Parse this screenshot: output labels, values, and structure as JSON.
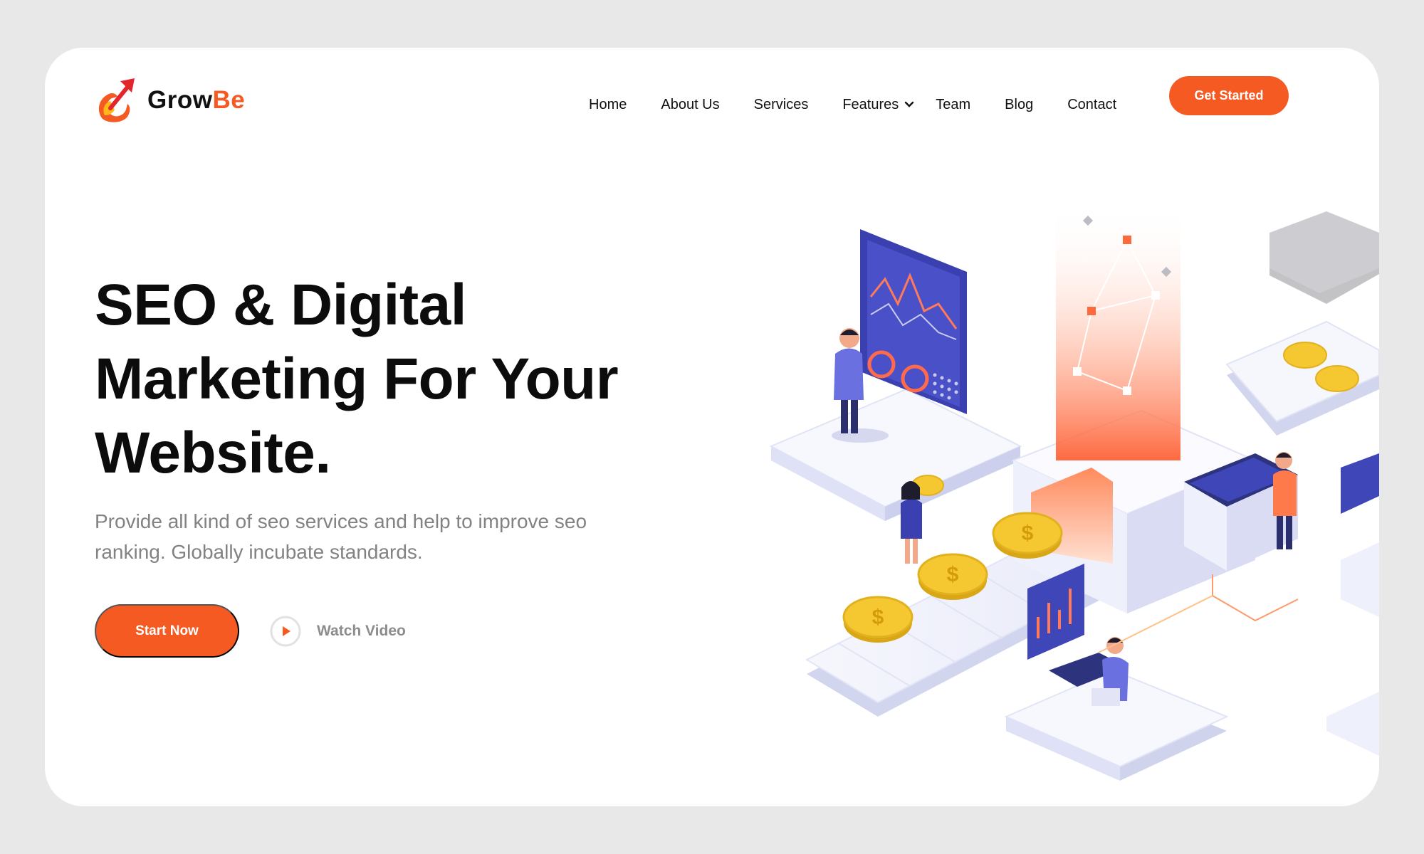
{
  "brand": {
    "name_part1": "Grow",
    "name_part2": "Be",
    "logo_icon": "rocket-arrow-icon",
    "accent_color": "#f55a22"
  },
  "nav": {
    "items": [
      {
        "label": "Home"
      },
      {
        "label": "About Us"
      },
      {
        "label": "Services"
      },
      {
        "label": "Features",
        "has_dropdown": true
      },
      {
        "label": "Team"
      },
      {
        "label": "Blog"
      },
      {
        "label": "Contact"
      }
    ],
    "cta_label": "Get Started"
  },
  "hero": {
    "title_line1": "SEO & Digital",
    "title_line2": "Marketing For Your",
    "title_line3": "Website.",
    "description_line1": "Provide all kind of seo services and help to improve seo",
    "description_line2": "ranking. Globally incubate standards.",
    "primary_button": "Start Now",
    "secondary_button": "Watch Video",
    "secondary_icon": "play-icon"
  },
  "illustration": {
    "subject": "isometric-seo-platform-illustration",
    "colors": {
      "coin": "#f2c230",
      "panel": "#3f46b8",
      "glow": "#ff6a3d",
      "platform": "#eef0fb"
    }
  }
}
